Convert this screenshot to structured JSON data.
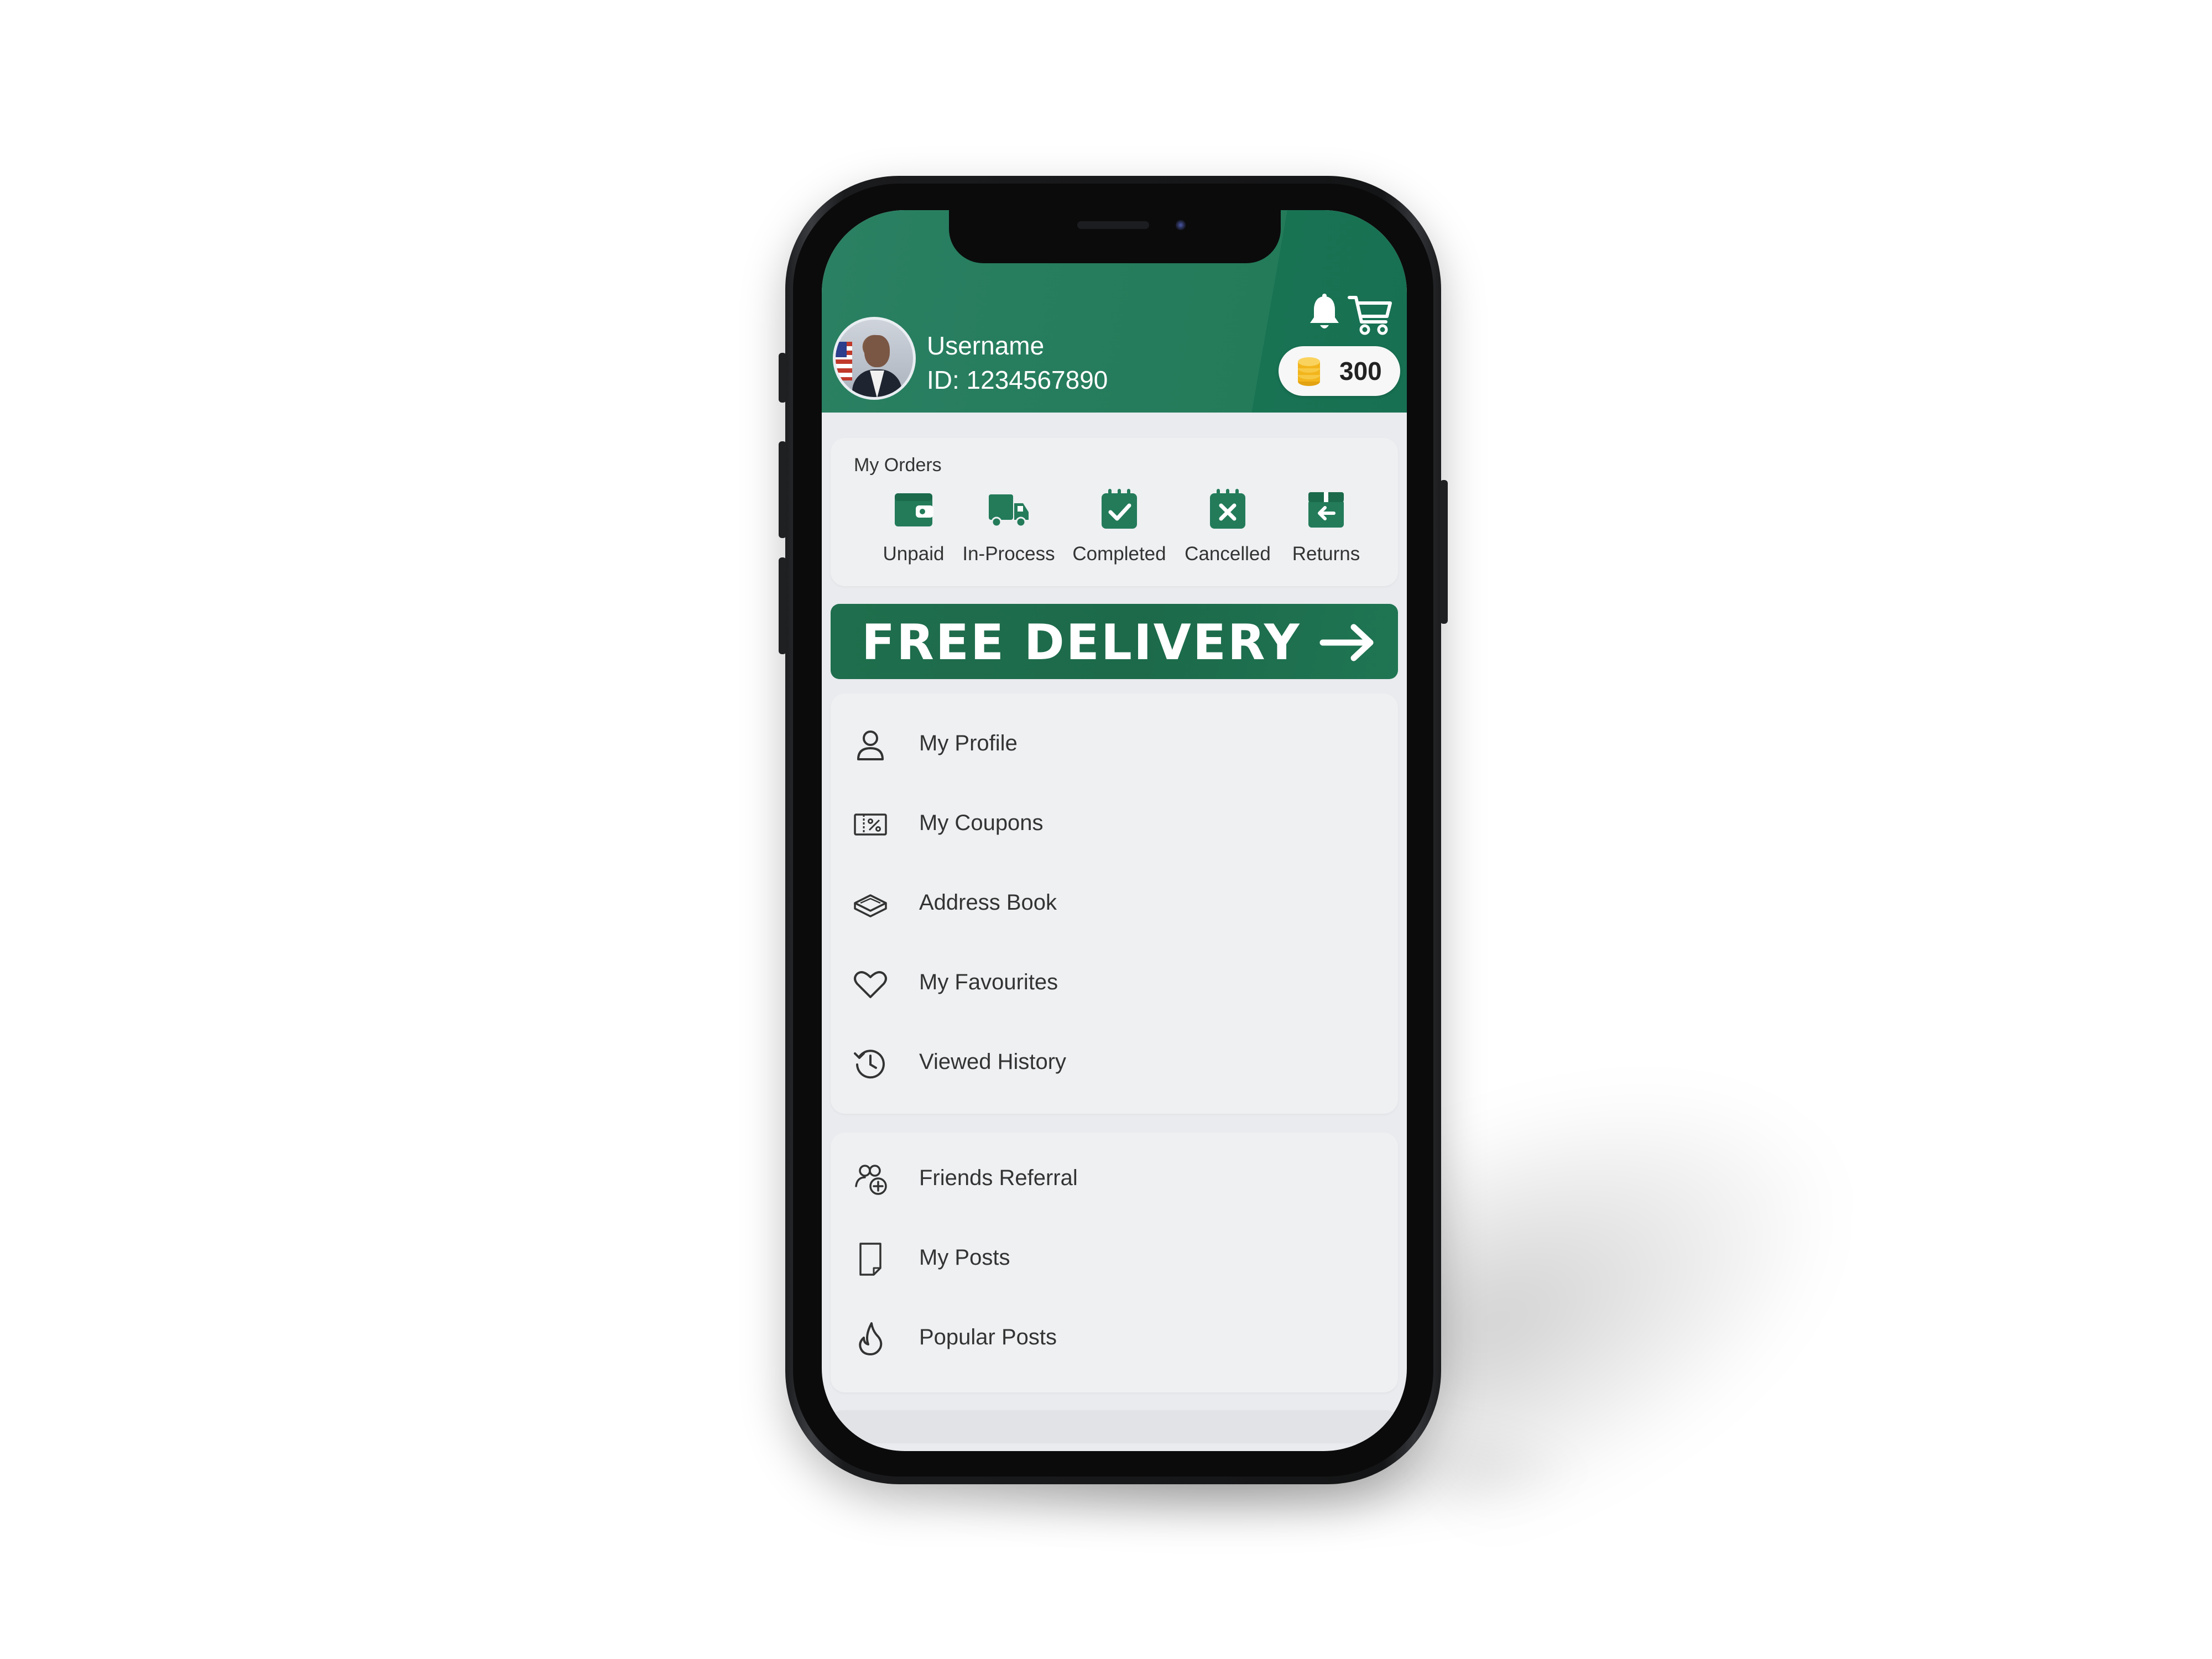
{
  "header": {
    "username": "Username",
    "user_id": "ID: 1234567890",
    "coins": "300",
    "icons": [
      "bell-icon",
      "cart-icon",
      "coin-icon"
    ]
  },
  "orders": {
    "title": "My Orders",
    "items": [
      {
        "label": "Unpaid",
        "icon": "wallet-icon"
      },
      {
        "label": "In-Process",
        "icon": "truck-icon"
      },
      {
        "label": "Completed",
        "icon": "calendar-check-icon"
      },
      {
        "label": "Cancelled",
        "icon": "calendar-x-icon"
      },
      {
        "label": "Returns",
        "icon": "box-return-icon"
      }
    ]
  },
  "banner": {
    "text": "FREE DELIVERY",
    "icon": "arrow-right-icon"
  },
  "menu_group_1": [
    {
      "label": "My Profile",
      "icon": "user-icon"
    },
    {
      "label": "My Coupons",
      "icon": "coupon-icon"
    },
    {
      "label": "Address Book",
      "icon": "book-icon"
    },
    {
      "label": "My Favourites",
      "icon": "heart-icon"
    },
    {
      "label": "Viewed History",
      "icon": "history-icon"
    }
  ],
  "menu_group_2": [
    {
      "label": "Friends Referral",
      "icon": "referral-icon"
    },
    {
      "label": "My Posts",
      "icon": "post-icon"
    },
    {
      "label": "Popular Posts",
      "icon": "flame-icon"
    }
  ],
  "colors": {
    "brand_green": "#237b5a",
    "banner_green": "#1f6e4d",
    "coin_gold": "#f2b51c",
    "background": "#e9ebee"
  }
}
